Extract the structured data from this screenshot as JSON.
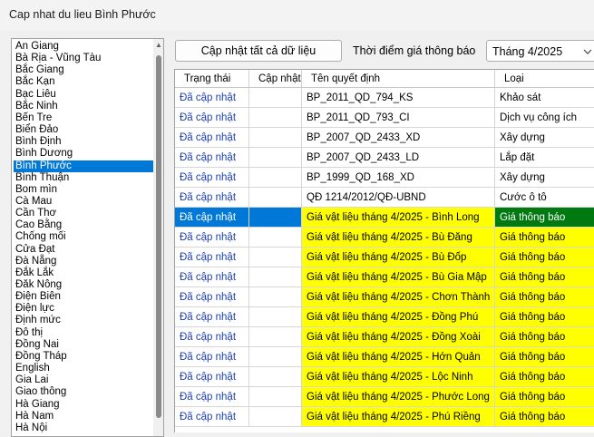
{
  "window": {
    "title": "Cap nhat du lieu Bình Phước"
  },
  "provinces": {
    "items": [
      "An Giang",
      "Bà Rịa - Vũng Tàu",
      "Bắc Giang",
      "Bắc Kạn",
      "Bạc Liêu",
      "Bắc Ninh",
      "Bến Tre",
      "Biển Đảo",
      "Bình Định",
      "Bình Dương",
      "Bình Phước",
      "Bình Thuận",
      "Bom mìn",
      "Cà Mau",
      "Cần Thơ",
      "Cao Bằng",
      "Chống mối",
      "Cửa Đạt",
      "Đà Nẵng",
      "Đắk Lắk",
      "Đăk Nông",
      "Điện Biên",
      "Điện lực",
      "Định mức",
      "Đô thị",
      "Đồng Nai",
      "Đồng Tháp",
      "English",
      "Gia Lai",
      "Giao thông",
      "Hà Giang",
      "Hà Nam",
      "Hà Nội"
    ],
    "selected_index": 10
  },
  "toolbar": {
    "update_all_label": "Cập nhật tất cả dữ liệu",
    "time_label": "Thời điểm giá thông báo",
    "period_value": "Tháng 4/2025"
  },
  "grid": {
    "columns": [
      "Trạng thái",
      "Cập nhật",
      "Tên quyết định",
      "Loại"
    ],
    "rows": [
      {
        "status": "Đã cập nhật",
        "update": "",
        "name": "BP_2011_QD_794_KS",
        "type": "Khảo sát",
        "style": "normal"
      },
      {
        "status": "Đã cập nhật",
        "update": "",
        "name": "BP_2011_QD_793_CI",
        "type": "Dịch vụ công ích",
        "style": "normal"
      },
      {
        "status": "Đã cập nhật",
        "update": "",
        "name": "BP_2007_QD_2433_XD",
        "type": "Xây dựng",
        "style": "normal"
      },
      {
        "status": "Đã cập nhật",
        "update": "",
        "name": "BP_2007_QD_2433_LD",
        "type": "Lắp đặt",
        "style": "normal"
      },
      {
        "status": "Đã cập nhật",
        "update": "",
        "name": "BP_1999_QD_168_XD",
        "type": "Xây dựng",
        "style": "normal"
      },
      {
        "status": "Đã cập nhật",
        "update": "",
        "name": "QĐ 1214/2012/QĐ-UBND",
        "type": "Cước ô tô",
        "style": "normal"
      },
      {
        "status": "Đã cập nhật",
        "update": "",
        "name": "Giá vật liệu tháng 4/2025 - Bình Long",
        "type": "Giá thông báo",
        "style": "selected"
      },
      {
        "status": "Đã cập nhật",
        "update": "",
        "name": "Giá vật liệu tháng 4/2025 - Bù Đăng",
        "type": "Giá thông báo",
        "style": "yellow"
      },
      {
        "status": "Đã cập nhật",
        "update": "",
        "name": "Giá vật liệu tháng 4/2025 - Bù Đốp",
        "type": "Giá thông báo",
        "style": "yellow"
      },
      {
        "status": "Đã cập nhật",
        "update": "",
        "name": "Giá vật liệu tháng 4/2025 - Bù Gia Mập",
        "type": "Giá thông báo",
        "style": "yellow"
      },
      {
        "status": "Đã cập nhật",
        "update": "",
        "name": "Giá vật liệu tháng 4/2025 - Chơn Thành",
        "type": "Giá thông báo",
        "style": "yellow"
      },
      {
        "status": "Đã cập nhật",
        "update": "",
        "name": "Giá vật liệu tháng 4/2025 - Đồng Phú",
        "type": "Giá thông báo",
        "style": "yellow"
      },
      {
        "status": "Đã cập nhật",
        "update": "",
        "name": "Giá vật liệu tháng 4/2025 - Đồng Xoài",
        "type": "Giá thông báo",
        "style": "yellow"
      },
      {
        "status": "Đã cập nhật",
        "update": "",
        "name": "Giá vật liệu tháng 4/2025 - Hớn Quản",
        "type": "Giá thông báo",
        "style": "yellow"
      },
      {
        "status": "Đã cập nhật",
        "update": "",
        "name": "Giá vật liệu tháng 4/2025 - Lộc Ninh",
        "type": "Giá thông báo",
        "style": "yellow"
      },
      {
        "status": "Đã cập nhật",
        "update": "",
        "name": "Giá vật liệu tháng 4/2025 - Phước Long",
        "type": "Giá thông báo",
        "style": "yellow"
      },
      {
        "status": "Đã cập nhật",
        "update": "",
        "name": "Giá vật liệu tháng 4/2025 - Phú Riềng",
        "type": "Giá thông báo",
        "style": "yellow"
      }
    ]
  },
  "colors": {
    "selection": "#0078d7",
    "highlight": "#ffff00",
    "selected_type": "#007a10",
    "status_text": "#1c3fb0"
  }
}
